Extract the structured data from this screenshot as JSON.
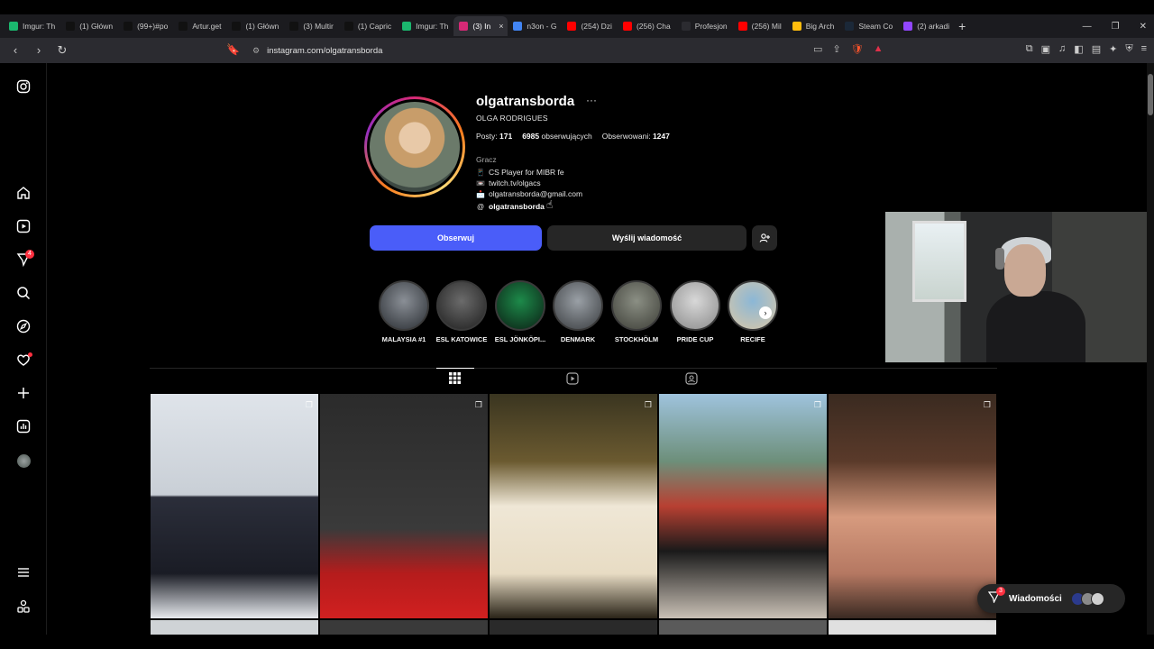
{
  "browser": {
    "tabs": [
      {
        "label": "Imgur: Th",
        "color": "#1bb76e",
        "icon": "imgur-icon"
      },
      {
        "label": "(1) Główn",
        "color": "#111111",
        "icon": "x-icon"
      },
      {
        "label": "(99+)#po",
        "color": "#111111",
        "icon": "tiktok-icon"
      },
      {
        "label": "Artur.get",
        "color": "#111111",
        "icon": "tiktok-icon"
      },
      {
        "label": "(1) Główn",
        "color": "#111111",
        "icon": "x-icon"
      },
      {
        "label": "(3) Multir",
        "color": "#111111",
        "icon": "x-icon"
      },
      {
        "label": "(1) Capric",
        "color": "#111111",
        "icon": "x-icon"
      },
      {
        "label": "Imgur: Th",
        "color": "#1bb76e",
        "icon": "imgur-icon"
      },
      {
        "label": "(3) In",
        "color": "#d62976",
        "icon": "instagram-icon",
        "active": true
      },
      {
        "label": "n3on - G",
        "color": "#4285f4",
        "icon": "google-icon"
      },
      {
        "label": "(254) Dzi",
        "color": "#ff0000",
        "icon": "youtube-icon"
      },
      {
        "label": "(256) Cha",
        "color": "#ff0000",
        "icon": "youtube-icon"
      },
      {
        "label": "Profesjon",
        "color": "#2b2b30",
        "icon": "blank-icon"
      },
      {
        "label": "(256) Mil",
        "color": "#ff0000",
        "icon": "youtube-icon"
      },
      {
        "label": "Big Arch",
        "color": "#ffbc0d",
        "icon": "mcdonalds-icon"
      },
      {
        "label": "Steam Co",
        "color": "#1b2838",
        "icon": "steam-icon"
      },
      {
        "label": "(2) arkadi",
        "color": "#9146ff",
        "icon": "twitch-icon"
      }
    ],
    "tab_close": "×",
    "new_tab": "+",
    "url": "instagram.com/olgatransborda"
  },
  "profile": {
    "username": "olgatransborda",
    "more": "···",
    "full_name": "OLGA RODRIGUES",
    "posts_label": "Posty:",
    "posts_count": "171",
    "followers_count": "6985",
    "followers_label": "obserwujących",
    "following_label": "Obserwowani:",
    "following_count": "1247",
    "category": "Gracz",
    "bio_lines": [
      {
        "icon": "📱",
        "text": "CS Player for MIBR fe"
      },
      {
        "icon": "📼",
        "text": "twitch.tv/olgacs"
      },
      {
        "icon": "📩",
        "text": "olgatransborda@gmail.com"
      }
    ],
    "threads_handle": "olgatransborda",
    "follow_label": "Obserwuj",
    "message_label": "Wyślij wiadomość"
  },
  "highlights": [
    {
      "label": "MALAYSIA #1",
      "c1": "#8a8f96",
      "c2": "#2a2e33"
    },
    {
      "label": "ESL KATOWICE",
      "c1": "#6b6b6b",
      "c2": "#1f1f1f"
    },
    {
      "label": "ESL JÖNKÖPI...",
      "c1": "#1d8a4a",
      "c2": "#0b1f14"
    },
    {
      "label": "DENMARK",
      "c1": "#9aa0a6",
      "c2": "#3a3d40"
    },
    {
      "label": "STOCKHÖLM",
      "c1": "#8b8f84",
      "c2": "#3e3f38"
    },
    {
      "label": "PRIDE CUP",
      "c1": "#d8d8d8",
      "c2": "#8a8a8a"
    },
    {
      "label": "RECIFE",
      "c1": "#8bb7d6",
      "c2": "#d9c7a8"
    }
  ],
  "posts": [
    {
      "bg": "linear-gradient(180deg,#dfe4ea 0%,#c9cfd6 45%,#2b2e3a 46%,#1a1c25 80%,#e6e9ed 100%)"
    },
    {
      "bg": "linear-gradient(180deg,#2b2b2b 0%,#3a3a3a 60%,#b51c1c 80%,#d12020 100%)"
    },
    {
      "bg": "linear-gradient(180deg,#3a3520 0%,#6b5a30 30%,#efe7d6 50%,#e8dcc4 80%,#2a2418 100%)"
    },
    {
      "bg": "linear-gradient(180deg,#9fc3dd 0%,#6d8f7a 30%,#b84032 50%,#1a1a1a 70%,#c9c0b5 100%)"
    },
    {
      "bg": "linear-gradient(180deg,#3a2a20 0%,#5a3a2a 30%,#d69a7e 55%,#b57862 80%,#3a2a22 100%)"
    }
  ],
  "messages": {
    "label": "Wiadomości",
    "badge": "3"
  },
  "sidebar": {
    "notification_badge": "4"
  }
}
